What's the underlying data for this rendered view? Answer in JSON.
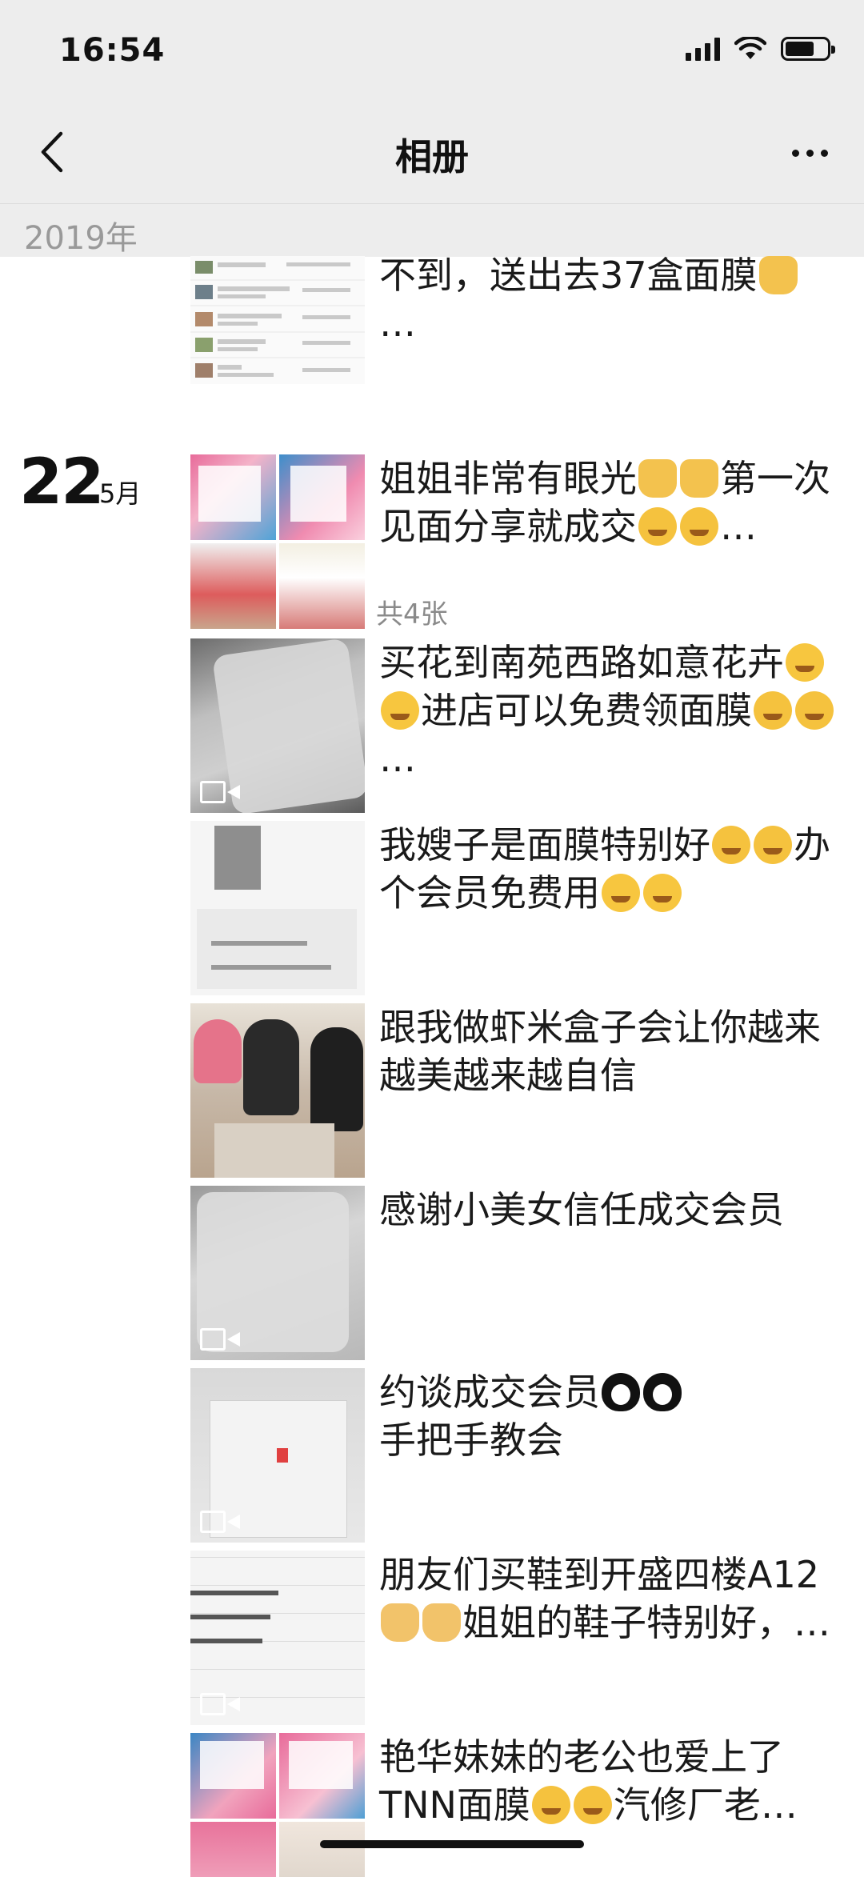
{
  "status_bar": {
    "time": "16:54"
  },
  "nav": {
    "title": "相册"
  },
  "year_section": {
    "label": "2019年"
  },
  "day_group": {
    "day": "22",
    "month": "5月",
    "count_label": "共4张"
  },
  "entries": [
    {
      "text": "不到，送出去37盒面膜",
      "suffix": "…",
      "emojis": [
        "thumb-up"
      ],
      "media": "screenshot"
    },
    {
      "text_a": "姐姐非常有眼光",
      "text_b": "第一次见面分享就成交",
      "suffix": "…",
      "media": "collage"
    },
    {
      "text_a": "买花到南苑西路如意花卉",
      "text_b": "进店可以免费领面膜",
      "suffix": "…",
      "media": "video"
    },
    {
      "text_a": "我嫂子是面膜特别好",
      "text_b": "办个会员免费用",
      "media": "screenshot"
    },
    {
      "text": "跟我做虾米盒子会让你越来越美越来越自信",
      "media": "photo"
    },
    {
      "text": "感谢小美女信任成交会员",
      "media": "video"
    },
    {
      "text_a": "约谈成交会员",
      "text_b": "手把手教会",
      "media": "video"
    },
    {
      "text_a": "朋友们买鞋到开盛四楼A12",
      "text_b": "姐姐的鞋子特别好，",
      "suffix": "…",
      "media": "video"
    },
    {
      "text_a": "艳华妹妹的老公也爱上了TNN面膜",
      "text_b": "汽修厂老",
      "suffix": "…",
      "media": "collage"
    }
  ]
}
